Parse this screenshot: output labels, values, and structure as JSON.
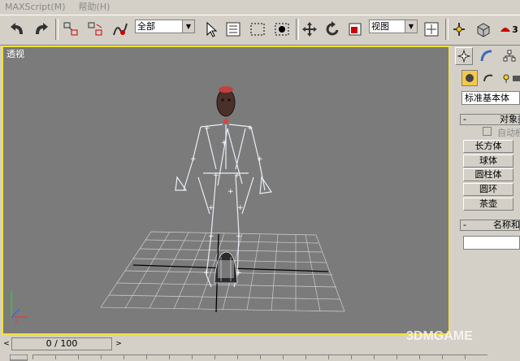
{
  "menu": {
    "maxscript": "MAXScript(M)",
    "help": "帮助(H)"
  },
  "toolbar": {
    "selection_filter": "全部",
    "coord_system": "视图",
    "render_label": "3"
  },
  "viewport": {
    "label": "透视"
  },
  "command_panel": {
    "category": "标准基本体",
    "object_type_title": "对象类型",
    "autogrid_label": "自动栅格",
    "primitives": [
      "长方体",
      "球体",
      "圆柱体",
      "圆环",
      "茶壶"
    ],
    "name_color_title": "名称和颜色",
    "rollout_minus": "-"
  },
  "timeslider": {
    "frame": "0 / 100",
    "prev": "<",
    "next": ">"
  },
  "watermark": "3DMGAME"
}
